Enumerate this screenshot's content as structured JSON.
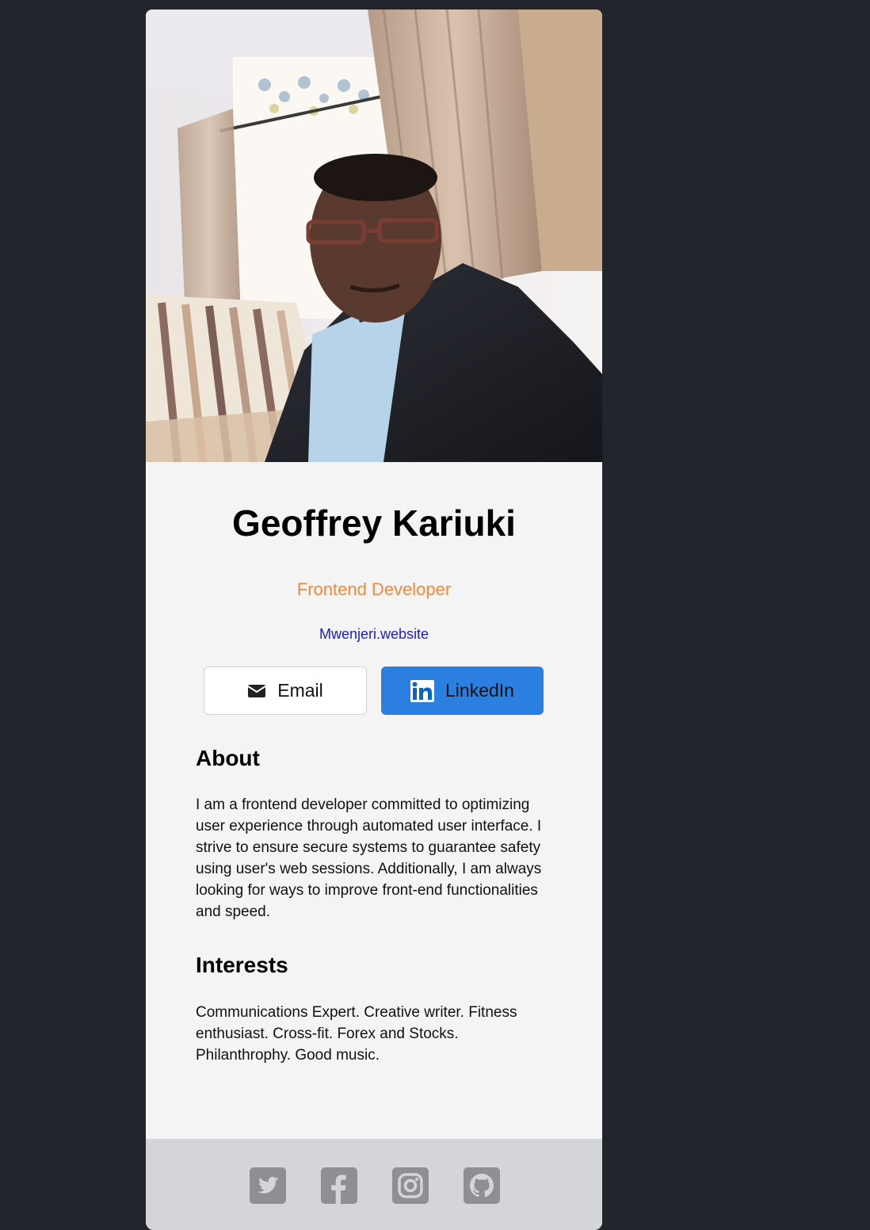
{
  "profile": {
    "name": "Geoffrey Kariuki",
    "role": "Frontend Developer",
    "website": "Mwenjeri.website"
  },
  "actions": {
    "email_label": "Email",
    "linkedin_label": "LinkedIn"
  },
  "about": {
    "title": "About",
    "text": "I am a frontend developer committed to optimizing user experience through automated user interface. I strive to ensure secure systems to guarantee safety using user's web sessions. Additionally, I am always looking for ways to improve front-end functionalities and speed."
  },
  "interests": {
    "title": "Interests",
    "text": "Communications Expert. Creative writer. Fitness enthusiast. Cross-fit. Forex and Stocks. Philanthrophy. Good music."
  },
  "footer": {
    "icons": [
      "twitter-icon",
      "facebook-icon",
      "instagram-icon",
      "github-icon"
    ]
  },
  "colors": {
    "role": "#f08a3a",
    "website_link": "#1b1fbf",
    "linkedin_button": "#2b7fe0",
    "card_background": "#f4f4f4",
    "footer_background": "#d4d5d8",
    "page_background": "#23252c",
    "social_icon": "#8e8f95"
  }
}
